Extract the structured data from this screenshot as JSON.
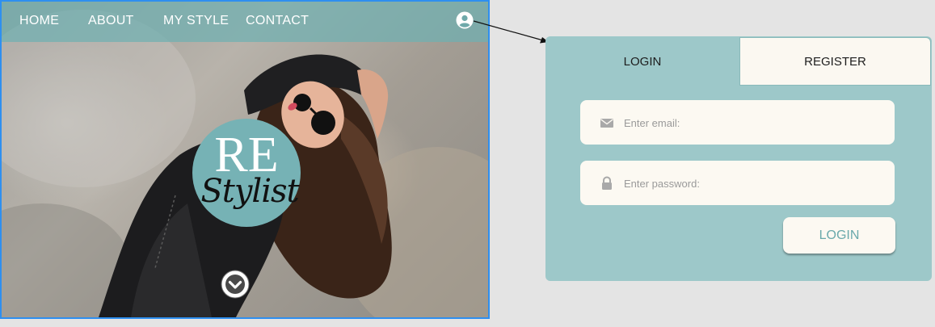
{
  "nav": {
    "links": [
      "HOME",
      "ABOUT",
      "MY STYLE",
      "CONTACT"
    ]
  },
  "icons": {
    "user": "user-circle-icon",
    "scroll": "chevron-down-circle-icon",
    "email": "envelope-icon",
    "password": "lock-icon"
  },
  "logo": {
    "line1": "RE",
    "line2": "Stylist"
  },
  "auth": {
    "tabs": {
      "login": "LOGIN",
      "register": "REGISTER"
    },
    "email_placeholder": "Enter email:",
    "password_placeholder": "Enter password:",
    "submit_label": "LOGIN"
  },
  "colors": {
    "frame_border": "#2e8ff0",
    "nav_overlay": "#6fb0b2",
    "logo_circle": "#76b2b5",
    "panel_bg": "#9dc8c9",
    "field_bg": "#fcf9f2",
    "button_text": "#6aa9ab",
    "page_bg": "#e4e4e4"
  }
}
